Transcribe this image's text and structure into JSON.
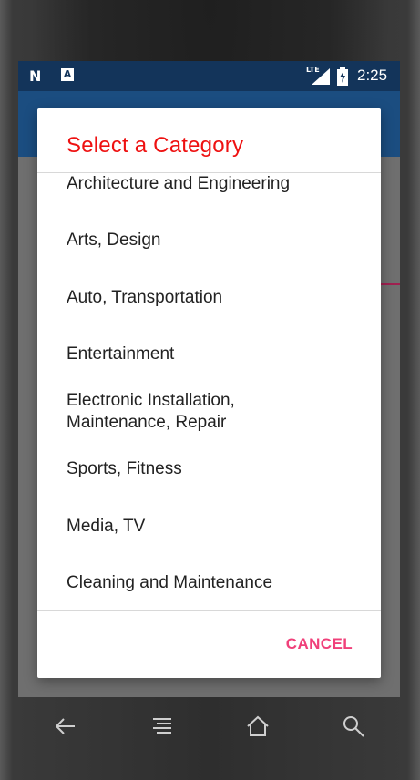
{
  "status_bar": {
    "left_icons": [
      "n-logo-icon",
      "a-notification-icon"
    ],
    "n_glyph": "N",
    "a_glyph": "A",
    "network_label": "LTE",
    "time": "2:25"
  },
  "dialog": {
    "title": "Select a Category",
    "items": [
      "Architecture and Engineering",
      "Arts, Design",
      "Auto, Transportation",
      "Entertainment",
      "Electronic Installation, Maintenance, Repair",
      "Sports, Fitness",
      "Media, TV",
      "Cleaning and Maintenance"
    ],
    "cancel_label": "CANCEL"
  },
  "colors": {
    "title": "#ee1111",
    "cancel": "#f0407a",
    "status_bar": "#13345a",
    "app_bar": "#1b4d80"
  },
  "navbar": {
    "icons": [
      "back-icon",
      "menu-icon",
      "home-icon",
      "search-icon"
    ]
  }
}
